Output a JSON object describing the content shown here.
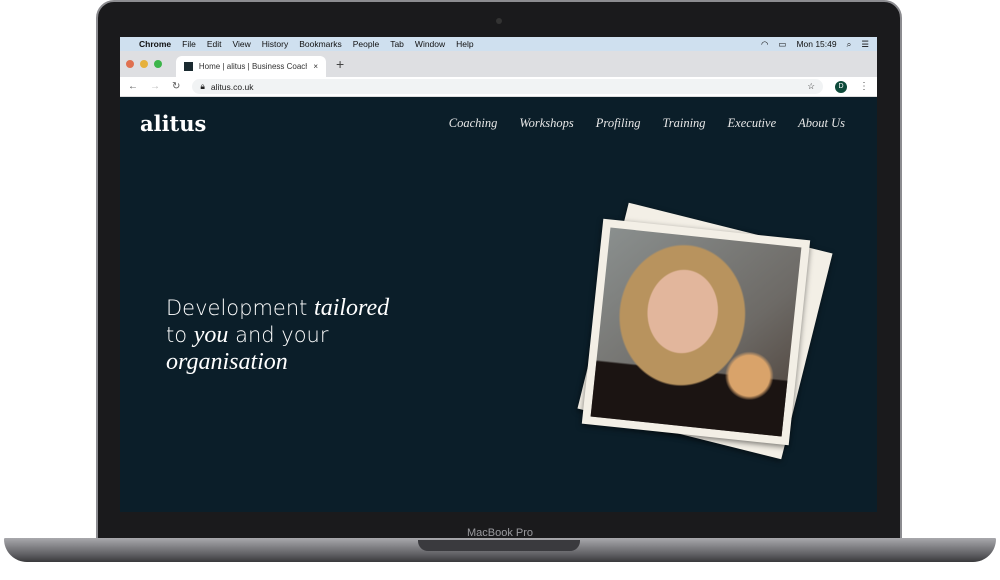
{
  "device": {
    "label": "MacBook Pro"
  },
  "menubar": {
    "apple_icon": "apple-icon",
    "items": [
      "Chrome",
      "File",
      "Edit",
      "View",
      "History",
      "Bookmarks",
      "People",
      "Tab",
      "Window",
      "Help"
    ],
    "clock": "Mon 15:49"
  },
  "browser": {
    "tab_title": "Home | alitus | Business Coach",
    "url": "alitus.co.uk",
    "profile_initial": "D",
    "traffic_colors": [
      "#e0704f",
      "#e6b13c",
      "#3cb54a"
    ]
  },
  "site": {
    "logo": "alitus",
    "nav": [
      "Coaching",
      "Workshops",
      "Profiling",
      "Training",
      "Executive",
      "About Us"
    ],
    "hero": {
      "t1": "Development ",
      "t2": "tailored",
      "t3": "to ",
      "t4": "you",
      "t5": " and your",
      "t6": "organisation"
    },
    "background_color": "#0b1e29"
  }
}
